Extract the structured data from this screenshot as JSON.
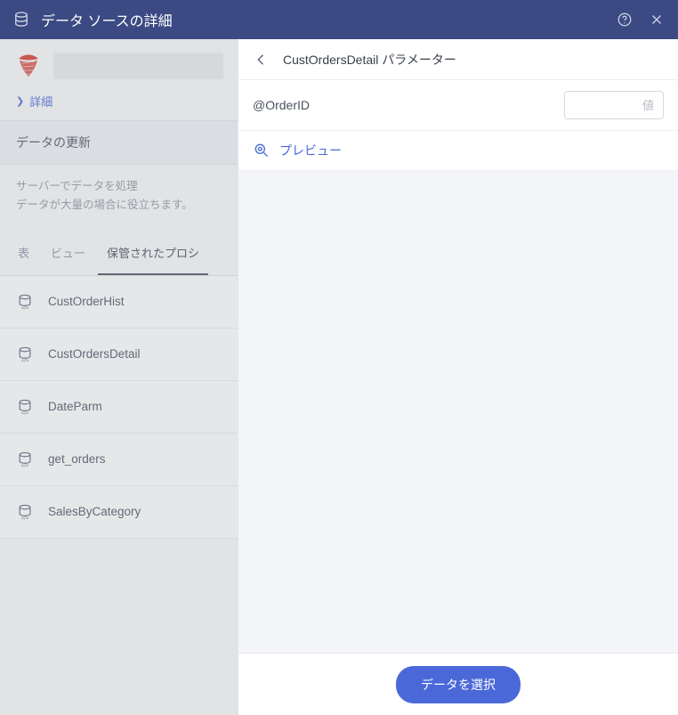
{
  "titlebar": {
    "title": "データ ソースの詳細"
  },
  "left": {
    "details_link": "詳細",
    "refresh_header": "データの更新",
    "refresh_desc_line1": "サーバーでデータを処理",
    "refresh_desc_line2": "データが大量の場合に役立ちます。",
    "tabs": {
      "tables": "表",
      "views": "ビュー",
      "procs": "保管されたプロシ"
    },
    "procedures": [
      {
        "label": "CustOrderHist"
      },
      {
        "label": "CustOrdersDetail"
      },
      {
        "label": "DateParm"
      },
      {
        "label": "get_orders"
      },
      {
        "label": "SalesByCategory"
      }
    ]
  },
  "right": {
    "panel_title": "CustOrdersDetail パラメーター",
    "param_name": "@OrderID",
    "param_placeholder": "値",
    "preview_label": "プレビュー",
    "select_button": "データを選択"
  }
}
